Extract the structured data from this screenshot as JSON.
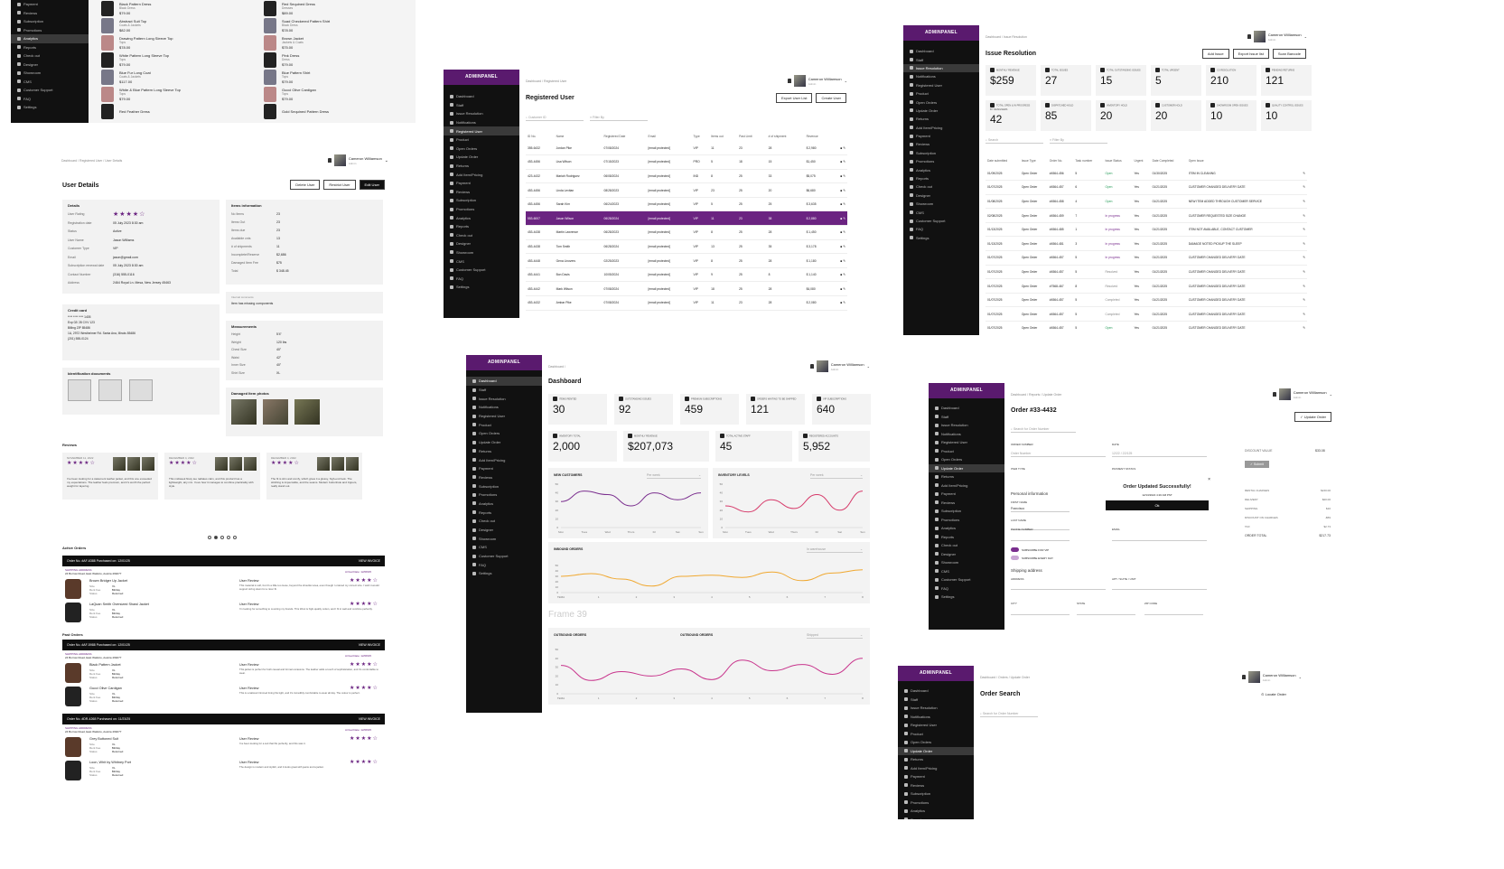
{
  "brand": "ADMINPANEL",
  "user": {
    "name": "Cameron Williamson",
    "role": "Admin"
  },
  "nav_full": [
    "Dashboard",
    "Staff",
    "Issue Resolution",
    "Notifications",
    "Registered User",
    "Product",
    "Open Orders",
    "Update Order",
    "Returns",
    "Add Item/Pricing",
    "Payment",
    "Reviews",
    "Subscription",
    "Promotions",
    "Analytics",
    "Reports",
    "Check out",
    "Designer",
    "Showroom",
    "CMS",
    "Customer Support",
    "FAQ",
    "Settings"
  ],
  "nav_top_left": [
    "Payment",
    "Reviews",
    "Subscription",
    "Promotions",
    "Analytics",
    "Reports",
    "Check out",
    "Designer",
    "Showroom",
    "CMS",
    "Customer Support",
    "FAQ",
    "Settings"
  ],
  "products_left": [
    {
      "name": "Black Pattern Dress",
      "cat": "Black Dress",
      "price": "$79.00"
    },
    {
      "name": "Abstract Suit Top",
      "cat": "Coats & Jackets",
      "price": "$82.00"
    },
    {
      "name": "Drawing Pattern Long Sleeve Top",
      "cat": "Tops",
      "price": "$78.00"
    },
    {
      "name": "White Pattern Long Sleeve Top",
      "cat": "Tops",
      "price": "$79.00"
    },
    {
      "name": "Blue Fur Long Coat",
      "cat": "Coats & Jackets",
      "price": "$117.00"
    },
    {
      "name": "White & Blue Pattern Long Sleeve Top",
      "cat": "Tops",
      "price": "$79.00"
    },
    {
      "name": "Red Feather Dress",
      "cat": "",
      "price": ""
    }
  ],
  "products_right": [
    {
      "name": "Red Sequined Dress",
      "cat": "Dresses",
      "price": "$89.00"
    },
    {
      "name": "Suad Checkered Pattern Shirt",
      "cat": "Black Dress",
      "price": "$78.00"
    },
    {
      "name": "Brown Jacket",
      "cat": "Jackets & Coats",
      "price": "$75.00"
    },
    {
      "name": "Pink Dress",
      "cat": "Dress",
      "price": "$79.00"
    },
    {
      "name": "Blue Pattern Shirt",
      "cat": "Tops",
      "price": "$79.00"
    },
    {
      "name": "Gucci Olive Cardigan",
      "cat": "Tops",
      "price": "$79.00"
    },
    {
      "name": "Gold Sequined Pattern Dress",
      "cat": "",
      "price": ""
    }
  ],
  "user_details": {
    "breadcrumb": "Dashboard / Registered User / User Details",
    "title": "User Details",
    "btn_delete": "Delete User",
    "btn_restrict": "Restrict User",
    "btn_edit": "Edit User",
    "details_title": "Details",
    "details": [
      [
        "User Rating",
        ""
      ],
      [
        "Registration date",
        "05 July 2023 8:30 am"
      ],
      [
        "Status",
        "Active"
      ],
      [
        "User Name",
        "Jason Williams"
      ],
      [
        "Customer Type",
        "VIP"
      ],
      [
        "Email",
        "jason@gmail.com"
      ],
      [
        "Subscription renewal date",
        "05 July 2023 8:30 am"
      ],
      [
        "Contact Number",
        "(316) 555-0116"
      ],
      [
        "Address",
        "2464 Royal Ln. Mesa, New Jersey 45463"
      ]
    ],
    "items_title": "Items information",
    "items": [
      [
        "No Items",
        "23"
      ],
      [
        "Items Out",
        "23"
      ],
      [
        "Items due",
        "23"
      ],
      [
        "Available cnts",
        "13"
      ],
      [
        "# of shipments",
        "11"
      ],
      [
        "Incomplete/Reserve",
        "$2,686"
      ],
      [
        "Damaged Item Fee",
        "$75"
      ],
      [
        "Total",
        "$ 348.45"
      ]
    ],
    "internal_title": "Internal comments",
    "internal_text": "Item has missing components",
    "cc_title": "Credit card",
    "cc_lines": [
      "**** **** **** 1405",
      "Exp 02/ 28 CVV 123",
      "Billing ZIP 85486",
      "1A, 2972 Westheimer Rd. Santa Ana, Illinois 85486",
      "(201) 555-0124"
    ],
    "meas_title": "Measurements",
    "meas": [
      [
        "Height",
        "5'4\""
      ],
      [
        "Weight",
        "120 lbs"
      ],
      [
        "Chest Size",
        "40\""
      ],
      [
        "Waist",
        "42\""
      ],
      [
        "Inner Size",
        "40\""
      ],
      [
        "Shirt Size",
        "XL"
      ]
    ],
    "id_title": "Identification documents",
    "damaged_title": "Damaged Item photos",
    "reviews_title": "Reviews",
    "reviews": [
      {
        "date": "NOVEMBER 11, 2022",
        "text": "I've been looking for a statement leather jacket, and this one exceeded my expectations. The leather feels premium, and it's worth the perfect weight for layering."
      },
      {
        "date": "DECEMBER 4, 2022",
        "text": "This midweek flowy tee radiates calm, and this product has a lightweight, airy mix. I love how it manages to combine practicality with style."
      },
      {
        "date": "DECEMBER 4, 2022",
        "text": "The fit is slim and comfy, which gives it a glossy, high-end look. The stitching is impeccable, and the seams. Modern buttonhole and zippers, really stand out."
      }
    ]
  },
  "orders": {
    "active_title": "Active Orders",
    "past_title": "Past Orders",
    "view_invoice": "VIEW INVOICE",
    "ship_label": "SHIPPING ADDRESS",
    "user_review": "User Review",
    "blocks": [
      {
        "order": "Order No. #AF-6388",
        "purchased": "Purchased on: 12/01/25",
        "address": "24 Burrow Road, East Watkins, Austria 499277",
        "arrival": "Arrival Date: 12/08/25",
        "items": [
          {
            "name": "Brown Bridger Up Jacket",
            "review": "This material is soft, but it's a little too loose, beyond the shoulder area, even though I ordered my correct size. I wish it would support sizing down for a nicer fit."
          },
          {
            "name": "LaQuan Smith Oversized Shawl Jacket",
            "review": "I'm looking for something to counting my brands. This Wool is high-quality cotton, and I fit in well and combine perfectly."
          }
        ]
      },
      {
        "order": "Order No. #AF-5988",
        "purchased": "Purchased on: 12/01/25",
        "address": "24 Burrow Road, East Watkins, Austria 499277",
        "arrival": "Arrival Date: 12/08/25",
        "items": [
          {
            "name": "Black Pattern Jacket",
            "review": "This jacket is perfect for both casual and formal occasions. The leather adds a touch of sophistication, and it's comfortable to wear."
          },
          {
            "name": "Gucci Olive Cardigan",
            "review": "This is a tailored trimmed lining fits tight, and it's incredibly comfortable to wear all day. The colour is perfect."
          }
        ]
      },
      {
        "order": "Order No. #DR-4268",
        "purchased": "Purchased on: 11/23/25",
        "address": "24 Burrow Road, East Watkins, Austria 499277",
        "arrival": "Arrival Date: 12/08/25",
        "items": [
          {
            "name": "Grey Buttoned Suit",
            "review": "I've been looking for a suit that fits perfectly, and this was it."
          },
          {
            "name": "Loon, Whit by Whitney Port",
            "review": "The design is modern and stylish, and it looks great with jeans and a jacket."
          }
        ]
      }
    ],
    "meta": [
      "Size",
      "Rent Fee",
      "Status"
    ],
    "meta_vals": [
      "XL",
      "$9/day",
      "Returned"
    ]
  },
  "registered": {
    "breadcrumb": "Dashboard / Registered User",
    "title": "Registered User",
    "btn_export": "Export User List",
    "btn_create": "Create User",
    "search_ph": "Customer ID",
    "filter_ph": "Filter By",
    "cols": [
      "ID No.",
      "Name",
      "Registered Date",
      "Email",
      "Type",
      "Items out",
      "Past Limit",
      "# of shipment",
      "Revenue"
    ],
    "rows": [
      [
        "355-6432",
        "Jordan Pike",
        "07/08/2024",
        "[email protected]",
        "VIP",
        "11",
        "23",
        "28",
        "$ 2,980"
      ],
      [
        "453-4456",
        "Lisa Wilson",
        "07/15/2023",
        "[email protected]",
        "PRO",
        "5",
        "18",
        "15",
        "$1,450"
      ],
      [
        "423-4432",
        "Mariah Rodriguez",
        "06/08/2024",
        "[email protected]",
        "IND",
        "8",
        "25",
        "33",
        "$5,075"
      ],
      [
        "453-4456",
        "Linda Levitan",
        "08/28/2023",
        "[email protected]",
        "VIP",
        "23",
        "25",
        "20",
        "$6,680"
      ],
      [
        "453-4456",
        "Sarah Kim",
        "06/24/2023",
        "[email protected]",
        "VIP",
        "5",
        "25",
        "25",
        "$ 3,635"
      ],
      [
        "553-6007",
        "Jason Wilson",
        "06/28/2024",
        "[email protected]",
        "VIP",
        "11",
        "23",
        "38",
        "$ 2,880"
      ],
      [
        "453-4438",
        "Martin Lawrence",
        "06/28/2023",
        "[email protected]",
        "VIP",
        "8",
        "25",
        "28",
        "$ 1,450"
      ],
      [
        "453-4438",
        "Tom Smith",
        "06/28/2024",
        "[email protected]",
        "VIP",
        "13",
        "25",
        "35",
        "$ 3,178"
      ],
      [
        "453-4448",
        "Gena Linovers",
        "02/25/2023",
        "[email protected]",
        "VIP",
        "8",
        "25",
        "28",
        "$ 1,180"
      ],
      [
        "453-4441",
        "Bon Davis",
        "10/05/2024",
        "[email protected]",
        "VIP",
        "9",
        "25",
        "8",
        "$ 1,140"
      ],
      [
        "453-4442",
        "Mark Wilson",
        "07/08/2024",
        "[email protected]",
        "VIP",
        "18",
        "25",
        "28",
        "$4,080"
      ],
      [
        "453-4432",
        "Ambar Pike",
        "07/08/2024",
        "[email protected]",
        "VIP",
        "11",
        "23",
        "28",
        "$ 2,080"
      ]
    ]
  },
  "issues": {
    "breadcrumb": "Dashboard / Issue Resolution",
    "title": "Issue Resolution",
    "btn_add": "Add Issue",
    "btn_export": "Export Issue list",
    "btn_scan": "Scan Barcode",
    "kpis": [
      [
        "MONTHLY REVENUE",
        "$259"
      ],
      [
        "TOTAL ISSUES",
        "27"
      ],
      [
        "TOTAL OUTSTANDING ISSUES",
        "15"
      ],
      [
        "TOTAL URGENT",
        "5"
      ],
      [
        "CS RESOLUTION",
        "210"
      ],
      [
        "PENDING RETURNS",
        "121"
      ],
      [
        "TOTAL OPEN & IN PROGRESS BY DESIGNERS",
        "42"
      ],
      [
        "DISPATCHED HOLD",
        "85"
      ],
      [
        "INVENTORY HOLD",
        "20"
      ],
      [
        "CUSTOMER HOLD",
        "20"
      ],
      [
        "SHOWROOM OPEN ISSUES",
        "10"
      ],
      [
        "QUALITY CONTROL ISSUES",
        "10"
      ]
    ],
    "search_ph": "Search",
    "filter_ph": "Filter By",
    "cols": [
      "Date submitted",
      "Issue Type",
      "Order No.",
      "Task number",
      "Issue Status",
      "Urgent",
      "Date Completed",
      "Open Issue"
    ],
    "rows": [
      [
        "01/09/2025",
        "Open Order",
        "#4564-456",
        "5",
        "Open",
        "Yes",
        "01/30/2025",
        "ITEM IN CLEANING"
      ],
      [
        "01/07/2025",
        "Open Order",
        "#4564-457",
        "6",
        "Open",
        "Yes",
        "01/21/2025",
        "CUSTOMER CHANGED DELIVERY DATE"
      ],
      [
        "01/08/2025",
        "Open Order",
        "#4564-458",
        "4",
        "Open",
        "Yes",
        "01/21/2025",
        "NEW ITEM ADDED THROUGH CUSTOMER SERVICE"
      ],
      [
        "02/08/2025",
        "Open Order",
        "#4564-459",
        "7",
        "In progress",
        "Yes",
        "01/21/2025",
        "CUSTOMER REQUESTED SIZE CHANGE"
      ],
      [
        "01/13/2025",
        "Open Order",
        "#4564-485",
        "1",
        "In progress",
        "Yes",
        "01/21/2025",
        "ITEM NOT AVAILABLE, CONTACT CUSTOMER"
      ],
      [
        "01/13/2025",
        "Open Order",
        "#4564-481",
        "3",
        "In progress",
        "Yes",
        "01/21/2025",
        "DAMAGE NOTED PICKUP THE SLEEP"
      ],
      [
        "01/07/2025",
        "Open Order",
        "#4564-457",
        "5",
        "In progress",
        "Yes",
        "01/21/2025",
        "CUSTOMER CHANGED DELIVERY DATE"
      ],
      [
        "01/07/2025",
        "Open Order",
        "#4564-457",
        "5",
        "Resolved",
        "Yes",
        "01/21/2025",
        "CUSTOMER CHANGED DELIVERY DATE"
      ],
      [
        "01/07/2025",
        "Open Order",
        "#7568-467",
        "8",
        "Resolved",
        "Yes",
        "01/21/2025",
        "CUSTOMER CHANGED DELIVERY DATE"
      ],
      [
        "01/07/2025",
        "Open Order",
        "#4564-457",
        "5",
        "Completed",
        "Yes",
        "01/21/2025",
        "CUSTOMER CHANGED DELIVERY DATE"
      ],
      [
        "01/07/2025",
        "Open Order",
        "#4564-457",
        "5",
        "Completed",
        "Yes",
        "01/21/2025",
        "CUSTOMER CHANGED DELIVERY DATE"
      ],
      [
        "01/07/2025",
        "Open Order",
        "#4564-457",
        "5",
        "Open",
        "Yes",
        "01/21/2025",
        "CUSTOMER CHANGED DELIVERY DATE"
      ]
    ]
  },
  "dashboard": {
    "breadcrumb": "Dashboard /",
    "title": "Dashboard",
    "kpis1": [
      [
        "ITEMS RENTED",
        "30"
      ],
      [
        "OUTSTANDING ISSUES",
        "92"
      ],
      [
        "PREMIUM SUBSCRIPTIONS",
        "459"
      ],
      [
        "ORDERS WAITING TO BE SHIPPED",
        "121"
      ],
      [
        "VIP SUBSCRIPTIONS",
        "640"
      ]
    ],
    "kpis2": [
      [
        "INVENTORY TOTAL",
        "2,000"
      ],
      [
        "MONTHLY REVENUE",
        "$207,073"
      ],
      [
        "TOTAL ACTIVE STAFF",
        "45"
      ],
      [
        "REGISTERED ACCOUNTS",
        "5,952"
      ]
    ],
    "frame_label": "Frame 39",
    "per_week": "Per week",
    "in_warehouse": "In warehouse",
    "shipped": "Shipped",
    "x_days": [
      "Mon",
      "Tues",
      "Wed",
      "Thurs",
      "Fri",
      "Sat",
      "Sun"
    ]
  },
  "chart_data": [
    {
      "type": "line",
      "title": "NEW CUSTOMERS",
      "x": [
        "Mon",
        "Tues",
        "Wed",
        "Thurs",
        "Fri",
        "Sat",
        "Sun"
      ],
      "yticks": [
        "50",
        "40",
        "30",
        "20",
        "10",
        "0"
      ],
      "series": [
        {
          "values": [
            30,
            42,
            38,
            25,
            40,
            32,
            40
          ]
        }
      ],
      "ylim": [
        0,
        50
      ],
      "color": "#7a2e8e"
    },
    {
      "type": "line",
      "title": "INVENTORY LEVELS",
      "x": [
        "Mon",
        "Tues",
        "Wed",
        "Thurs",
        "Fri",
        "Sat",
        "Sun"
      ],
      "yticks": [
        "50",
        "40",
        "30",
        "20",
        "10",
        "0"
      ],
      "series": [
        {
          "values": [
            25,
            18,
            32,
            22,
            38,
            20,
            42
          ]
        }
      ],
      "ylim": [
        0,
        50
      ],
      "color": "#d63a6a"
    },
    {
      "type": "line",
      "title": "INBOUND ORDERS",
      "x": [
        "TEMA",
        "1",
        "2",
        "3",
        "4",
        "5",
        "6",
        "7",
        "8"
      ],
      "yticks": [
        "50",
        "40",
        "30",
        "20",
        "10",
        "0"
      ],
      "series": [
        {
          "values": [
            30,
            35,
            25,
            12,
            30,
            32,
            28,
            38,
            22,
            36,
            42
          ]
        }
      ],
      "ylim": [
        0,
        50
      ],
      "color": "#f0a830"
    },
    {
      "type": "line",
      "title": "OUTBOUND ORDERS",
      "x": [
        "TEMA",
        "1",
        "2",
        "3",
        "4",
        "5",
        "6",
        "7",
        "8"
      ],
      "yticks": [
        "50",
        "40",
        "30",
        "20",
        "10",
        "0"
      ],
      "series": [
        {
          "values": [
            32,
            15,
            25,
            20,
            28,
            16,
            38,
            26,
            33,
            22,
            40
          ]
        }
      ],
      "ylim": [
        0,
        50
      ],
      "color": "#c8348c"
    }
  ],
  "outbound_mid_label": "OUTBOUND ORDERS",
  "update_order": {
    "breadcrumb": "Dashboard / Reports / Update Order",
    "title": "Order #33-4432",
    "btn_update": "Update Order",
    "search_ph": "Search for Order Number",
    "order_number_label": "ORDER NUMBER",
    "order_number_ph": "Order Number",
    "date_label": "DATE",
    "date_ph": "12/22 / 22/125",
    "item_type": "ITEM TYPE",
    "payment_status": "PAYMENT STATUS",
    "personal": "Personal information",
    "first_name": "FIRST NAME",
    "first_name_val": "Francisco",
    "last_name": "LAST NAME",
    "phone": "PHONE NUMBER",
    "email": "EMAIL",
    "toggle1": "SUBSCRIBE FOR VIP",
    "toggle2": "SUBSCRIBE EVERY DAY",
    "shipping": "Shipping address",
    "address": "ADDRESS",
    "apt": "APT / SUITE / UNIT",
    "city": "CITY",
    "state": "STATE",
    "zip": "ZIP CODE",
    "modal_title": "Order Updated Successfully!",
    "modal_sub": "12/13/2022 4:20 AM PST",
    "modal_ok": "Ok",
    "discount_label": "DISCOUNT VALUE",
    "discount_val": "$33.08",
    "submit": "Submit",
    "summary": [
      [
        "",
        ""
      ],
      [
        "RENTAL CHARGES",
        "$240.00"
      ],
      [
        "DELIVERY",
        "$20.00"
      ],
      [
        "SHIPPING",
        "$10"
      ],
      [
        "DISCOUNT ON CHARGES",
        "-$59"
      ],
      [
        "TAX",
        "$2.73"
      ],
      [
        "ORDER TOTAL",
        "$217.73"
      ]
    ]
  },
  "order_search": {
    "breadcrumb": "Dashboard / Orders / Update Order",
    "title": "Order Search",
    "locate": "Locate Order",
    "search_ph": "Search for Order Number"
  },
  "pager_dots": 5
}
